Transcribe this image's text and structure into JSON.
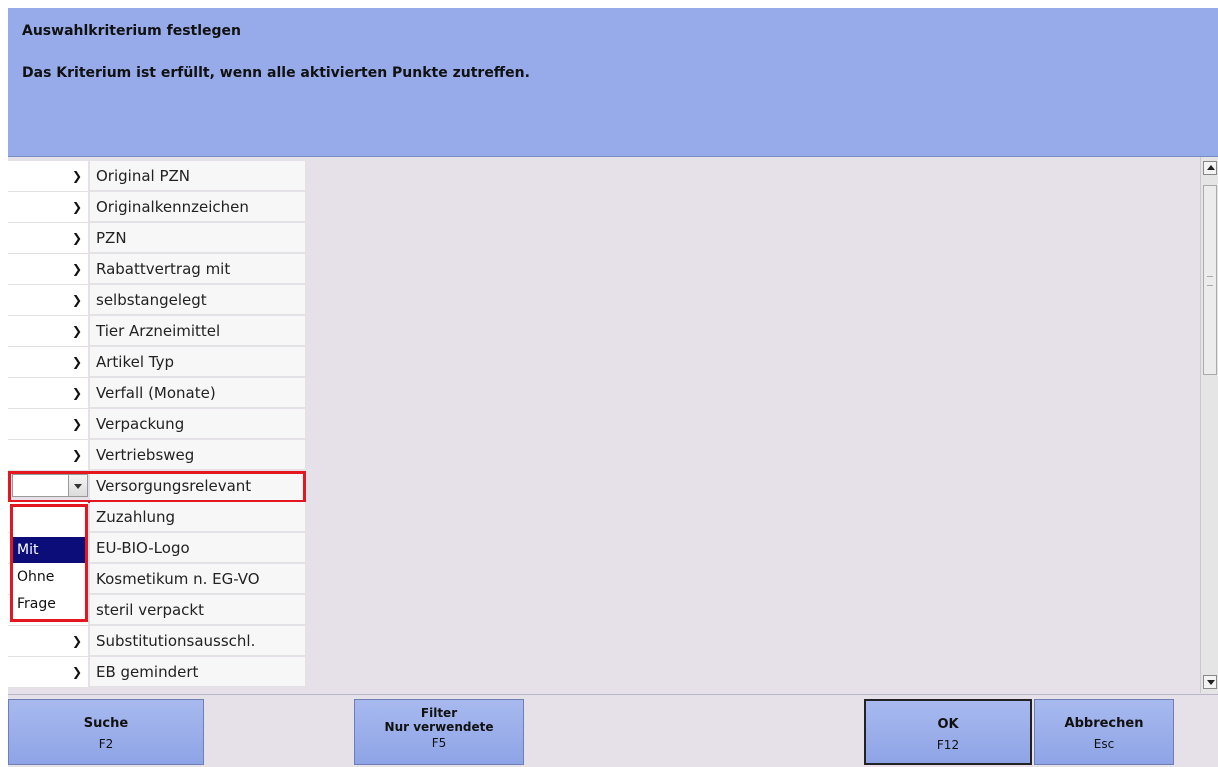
{
  "header": {
    "title": "Auswahlkriterium festlegen",
    "subtitle": "Das Kriterium ist erfüllt, wenn alle aktivierten Punkte zutreffen."
  },
  "rows": [
    {
      "label": "Original PZN"
    },
    {
      "label": "Originalkennzeichen"
    },
    {
      "label": "PZN"
    },
    {
      "label": "Rabattvertrag mit"
    },
    {
      "label": "selbstangelegt"
    },
    {
      "label": "Tier Arzneimittel"
    },
    {
      "label": "Artikel Typ"
    },
    {
      "label": "Verfall (Monate)"
    },
    {
      "label": "Verpackung"
    },
    {
      "label": "Vertriebsweg"
    },
    {
      "label": "Versorgungsrelevant"
    },
    {
      "label": "Zuzahlung"
    },
    {
      "label": "EU-BIO-Logo"
    },
    {
      "label": "Kosmetikum n. EG-VO"
    },
    {
      "label": "steril verpackt"
    },
    {
      "label": "Substitutionsausschl."
    },
    {
      "label": "EB gemindert"
    }
  ],
  "dropdown": {
    "options": [
      "",
      "Mit",
      "Ohne",
      "Frage"
    ],
    "highlighted": "Mit"
  },
  "footer": {
    "suche": {
      "label": "Suche",
      "key": "F2"
    },
    "filter": {
      "label1": "Filter",
      "label2": "Nur verwendete",
      "key": "F5"
    },
    "ok": {
      "label": "OK",
      "key": "F12"
    },
    "abbrechen": {
      "label": "Abbrechen",
      "key": "Esc"
    }
  },
  "colors": {
    "header_bg": "#97abea",
    "highlight_red": "#e3171f",
    "selected_option_bg": "#0d0d7a"
  },
  "icons": {
    "row_toggle": "chevron-down-icon",
    "scroll_up": "arrow-up-icon",
    "scroll_down": "arrow-down-icon"
  }
}
